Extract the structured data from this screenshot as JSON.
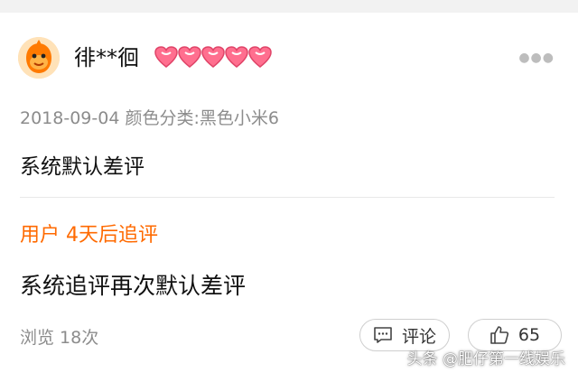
{
  "review": {
    "username": "徘**徊",
    "meta": "2018-09-04 颜色分类:黑色小米6",
    "body": "系统默认差评",
    "more_icon": "ellipsis-icon",
    "heart_color": "#ff6f8f"
  },
  "follow_up": {
    "tag": "用户 4天后追评",
    "body": "系统追评再次默认差评",
    "tag_color": "#ff6a00"
  },
  "footer": {
    "views": "浏览 18次",
    "comment_label": "评论",
    "like_count": "65"
  },
  "watermark": "头条 @肥仔第一线娱乐"
}
